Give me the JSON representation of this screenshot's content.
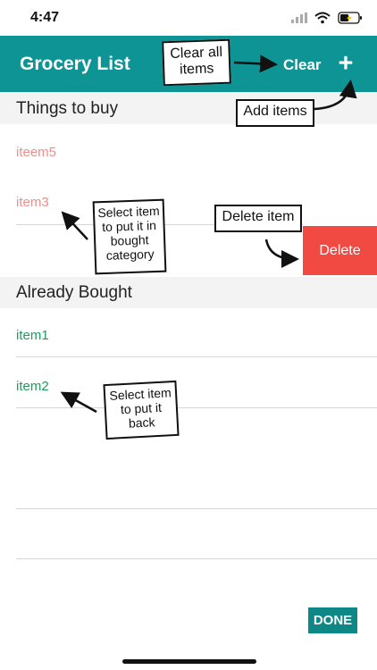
{
  "status_bar": {
    "time": "4:47"
  },
  "header": {
    "title": "Grocery List",
    "clear_label": "Clear",
    "add_label": "+"
  },
  "sections": {
    "to_buy": {
      "title": "Things to buy",
      "items": [
        "iteem5",
        "item3"
      ]
    },
    "bought": {
      "title": "Already Bought",
      "items": [
        "item1",
        "item2"
      ]
    }
  },
  "swipe_action": {
    "delete_label": "Delete"
  },
  "footer": {
    "done_label": "DONE"
  },
  "annotations": {
    "clear_all": "Clear all items",
    "add_items": "Add items",
    "select_to_buy": "Select item to put it in bought category",
    "delete_item": "Delete item",
    "select_put_back": "Select item to put it back"
  },
  "colors": {
    "header": "#0e9494",
    "to_buy_text": "#ee8e89",
    "bought_text": "#1f9a60",
    "delete": "#f04a43"
  }
}
